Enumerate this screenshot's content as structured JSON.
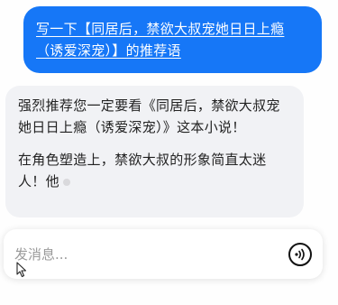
{
  "messages": {
    "user": {
      "text": "写一下【同居后，禁欲大叔宠她日日上瘾（诱爱深宠）】的推荐语"
    },
    "assistant": {
      "paragraph_1": "强烈推荐您一定要看《同居后，禁欲大叔宠她日日上瘾（诱爱深宠）》这本小说！",
      "paragraph_2": "在角色塑造上，禁欲大叔的形象简直太迷人！他"
    }
  },
  "composer": {
    "placeholder": "发消息..."
  },
  "icons": {
    "voice": "voice-wave-icon",
    "cursor": "mouse-pointer-icon"
  },
  "colors": {
    "user_bubble": "#1677f7",
    "assistant_bubble": "#f1f2f5"
  }
}
